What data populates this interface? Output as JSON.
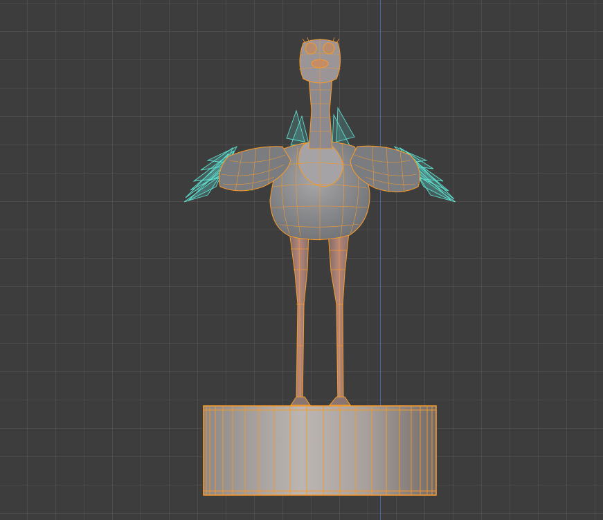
{
  "viewport": {
    "background": "#3d3d3d",
    "grid_color": "#4a4a4a",
    "axis_color": "#4a6fc4"
  },
  "selection": {
    "active_outline": "#f39a2e",
    "selected_outline": "#5ee0d0"
  },
  "objects": [
    {
      "name": "ostrich-body-mesh",
      "state": "active"
    },
    {
      "name": "ostrich-feathers",
      "state": "selected"
    },
    {
      "name": "pedestal-cylinder",
      "state": "active"
    }
  ]
}
